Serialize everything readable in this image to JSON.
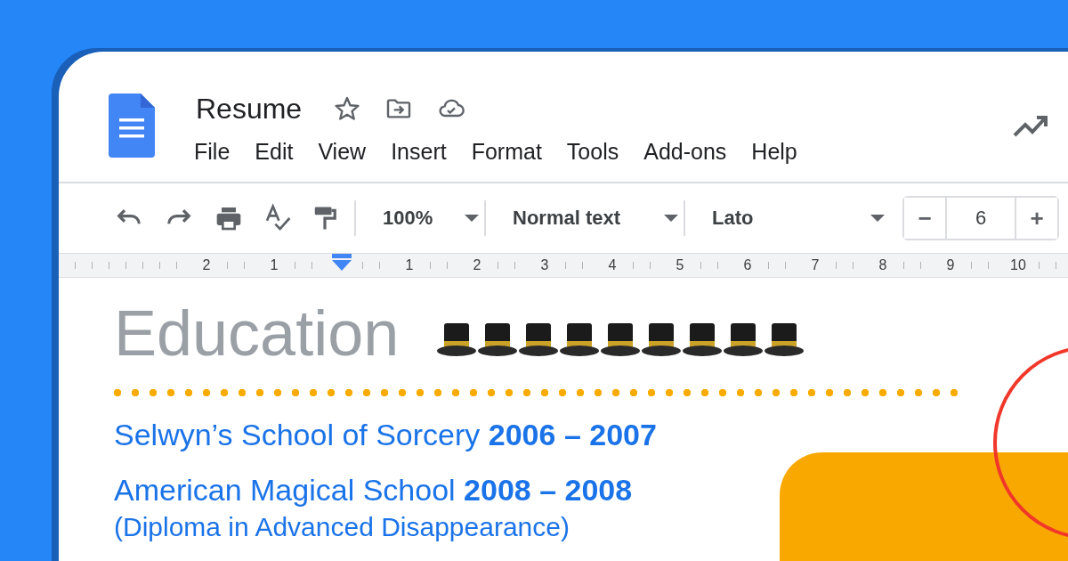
{
  "document": {
    "title": "Resume"
  },
  "title_icons": [
    {
      "kind": "star"
    },
    {
      "kind": "move"
    },
    {
      "kind": "cloud"
    }
  ],
  "menu": [
    "File",
    "Edit",
    "View",
    "Insert",
    "Format",
    "Tools",
    "Add-ons",
    "Help"
  ],
  "toolbar": {
    "zoom": "100%",
    "style": "Normal text",
    "font": "Lato",
    "font_size": "6",
    "decrease": "−",
    "increase": "+"
  },
  "ruler": {
    "left_labels": [
      "2",
      "1"
    ],
    "right_labels": [
      "1",
      "2",
      "3",
      "4",
      "5",
      "6",
      "7",
      "8",
      "9",
      "10"
    ]
  },
  "body": {
    "heading": "Education",
    "heading_decorations": [
      {
        "kind": "top-hat"
      },
      {
        "kind": "top-hat"
      },
      {
        "kind": "top-hat"
      },
      {
        "kind": "top-hat"
      },
      {
        "kind": "top-hat"
      },
      {
        "kind": "top-hat"
      },
      {
        "kind": "top-hat"
      },
      {
        "kind": "top-hat"
      },
      {
        "kind": "top-hat"
      }
    ],
    "entries": [
      {
        "line": "Selwyn’s School of Sorcery **2006 – 2007**"
      },
      {
        "line": "American Magical School **2008 – 2008**",
        "note": "(Diploma in Advanced Disappearance)"
      }
    ]
  }
}
